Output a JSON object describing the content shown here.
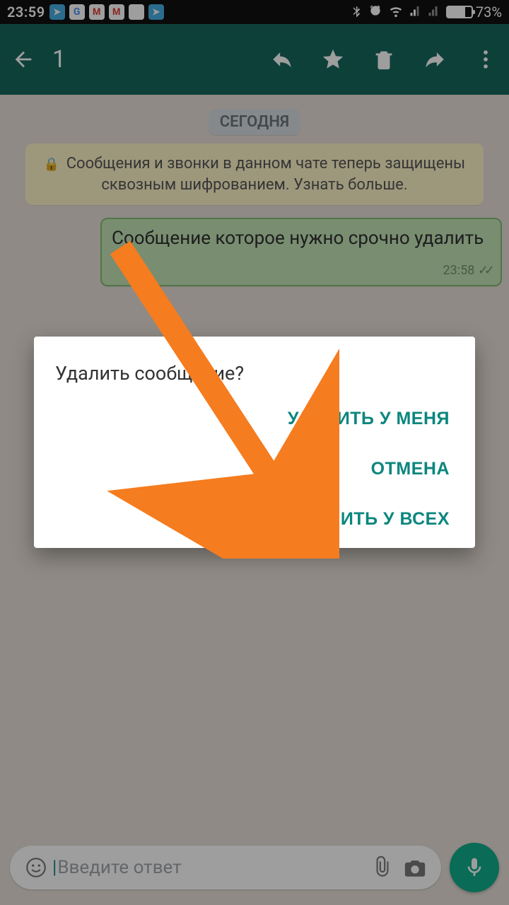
{
  "statusbar": {
    "time": "23:59",
    "battery_pct": "73%"
  },
  "actionbar": {
    "selected_count": "1"
  },
  "chat": {
    "date_chip": "СЕГОДНЯ",
    "encryption_notice": "Сообщения и звонки в данном чате теперь защищены сквозным шифрованием. Узнать больше.",
    "message": {
      "text": "Сообщение которое нужно срочно удалить",
      "time": "23:58"
    }
  },
  "input": {
    "placeholder": "Введите ответ"
  },
  "dialog": {
    "title": "Удалить сообщение?",
    "delete_for_me": "УДАЛИТЬ У МЕНЯ",
    "cancel": "ОТМЕНА",
    "delete_for_all": "УДАЛИТЬ У ВСЕХ"
  }
}
